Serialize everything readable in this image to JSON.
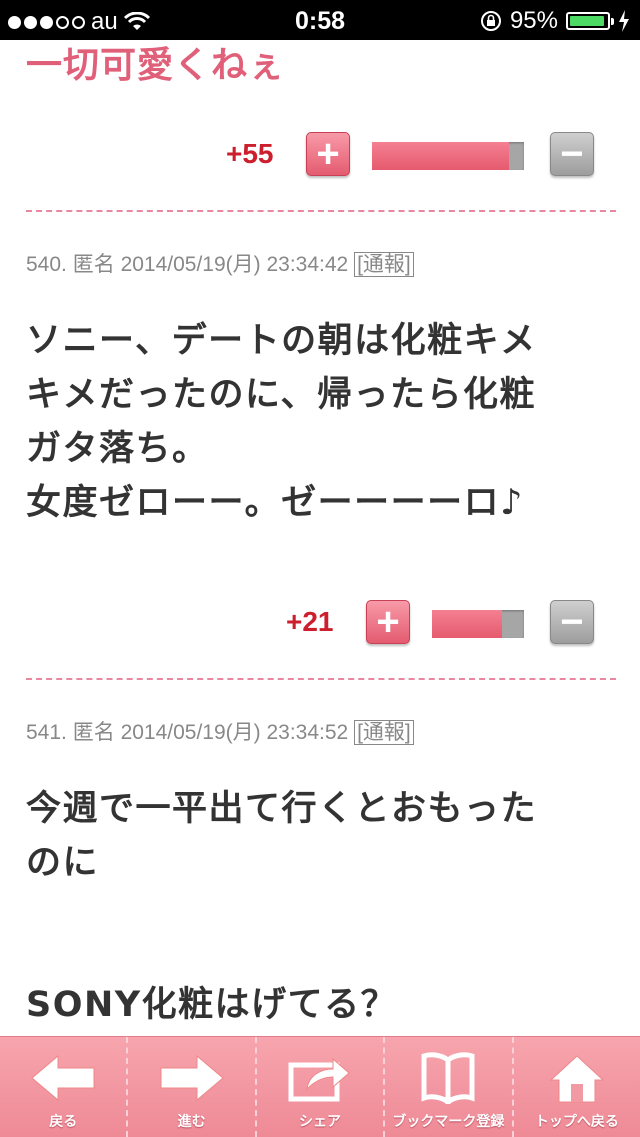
{
  "status_bar": {
    "carrier": "au",
    "time": "0:58",
    "battery_percent": "95%"
  },
  "comments": [
    {
      "text_lines": [
        "一切可愛くねぇ"
      ],
      "votes": {
        "score": "+55",
        "positive_ratio": 0.9
      }
    },
    {
      "number": "540.",
      "author": "匿名",
      "datetime": "2014/05/19(月) 23:34:42",
      "report_label": "[通報]",
      "text_lines": [
        "ソニー、デートの朝は化粧キメ",
        "キメだったのに、帰ったら化粧",
        "ガタ落ち。",
        "女度ゼローー。ゼーーーーロ♪"
      ],
      "votes": {
        "score": "+21",
        "positive_ratio": 0.76
      }
    },
    {
      "number": "541.",
      "author": "匿名",
      "datetime": "2014/05/19(月) 23:34:52",
      "report_label": "[通報]",
      "text_lines": [
        "今週で一平出て行くとおもった",
        "のに",
        "",
        "SONY化粧はげてる？"
      ]
    }
  ],
  "vote_buttons": {
    "plus": "+",
    "minus": "−"
  },
  "toolbar": {
    "items": [
      {
        "label": "戻る",
        "icon": "arrow-left-icon"
      },
      {
        "label": "進む",
        "icon": "arrow-right-icon"
      },
      {
        "label": "シェア",
        "icon": "share-icon"
      },
      {
        "label": "ブックマーク登録",
        "icon": "book-icon"
      },
      {
        "label": "トップへ戻る",
        "icon": "home-icon"
      }
    ]
  },
  "colors": {
    "accent_pink": "#e0607a",
    "score_red": "#cc1e2c",
    "toolbar_bg": "#f29aa4"
  }
}
